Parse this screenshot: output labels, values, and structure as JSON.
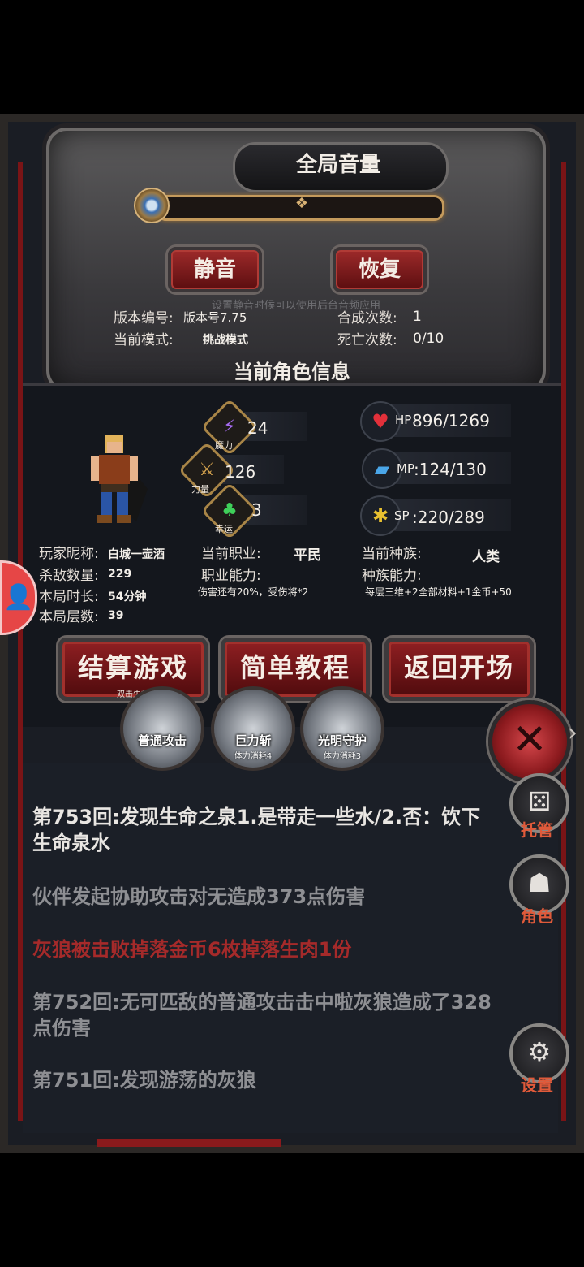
{
  "volume": {
    "title": "全局音量",
    "mute_label": "静音",
    "restore_label": "恢复",
    "hint": "设置静音时候可以使用后台音频应用"
  },
  "game_info": {
    "version_label": "版本编号:",
    "version_value": "版本号7.75",
    "mode_label": "当前模式:",
    "mode_value": "挑战模式",
    "craft_label": "合成次数:",
    "craft_value": "1",
    "death_label": "死亡次数:",
    "death_value": "0/10"
  },
  "character": {
    "section_title": "当前角色信息",
    "magic": {
      "value": "24",
      "label": "魔力"
    },
    "strength": {
      "value": "126",
      "label": "力量"
    },
    "luck": {
      "value": "3",
      "label": "幸运"
    },
    "hp": {
      "prefix": "HP",
      "value": "896/1269"
    },
    "mp": {
      "prefix": "MP",
      "value": ":124/130"
    },
    "sp": {
      "prefix": "SP",
      "value": ":220/289"
    },
    "nickname_label": "玩家昵称:",
    "nickname_value": "白城一壶酒",
    "kills_label": "杀敌数量:",
    "kills_value": "229",
    "duration_label": "本局时长:",
    "duration_value": "54分钟",
    "floors_label": "本局层数:",
    "floors_value": "39",
    "job_label": "当前职业:",
    "job_value": "平民",
    "job_ability_label": "职业能力:",
    "job_ability_value": "伤害还有20%，受伤将*2",
    "race_label": "当前种族:",
    "race_value": "人类",
    "race_ability_label": "种族能力:",
    "race_ability_value": "每层三维+2全部材料+1金币+50"
  },
  "actions": {
    "settle_label": "结算游戏",
    "settle_hint": "双击生效",
    "tutorial_label": "简单教程",
    "return_label": "返回开场"
  },
  "skills": [
    {
      "name": "普通攻击",
      "cost": ""
    },
    {
      "name": "巨力斩",
      "cost": "体力消耗4"
    },
    {
      "name": "光明守护",
      "cost": "体力消耗3"
    }
  ],
  "log": [
    {
      "text": "第753回:发现生命之泉1.是带走一些水/2.否：饮下生命泉水",
      "color": "#e9e6e2"
    },
    {
      "text": "伙伴发起协助攻击对无造成373点伤害",
      "color": "#8e8f93"
    },
    {
      "text": "灰狼被击败掉落金币6枚掉落生肉1份",
      "color": "#a52a2a"
    },
    {
      "text": "第752回:无可匹敌的普通攻击击中啦灰狼造成了328点伤害",
      "color": "#8e8f93"
    },
    {
      "text": "第751回:发现游荡的灰狼",
      "color": "#8e8f93"
    }
  ],
  "side_menu": {
    "auto_label": "托管",
    "role_label": "角色",
    "settings_label": "设置"
  },
  "icons": {
    "close": "close-icon",
    "avatar": "user-icon",
    "dice": "dice-icon",
    "hood": "hooded-figure-icon",
    "gear": "gear-icon"
  },
  "colors": {
    "accent_red": "#8f1f22",
    "log_red": "#a52a2a",
    "side_label": "#e05a3a"
  }
}
